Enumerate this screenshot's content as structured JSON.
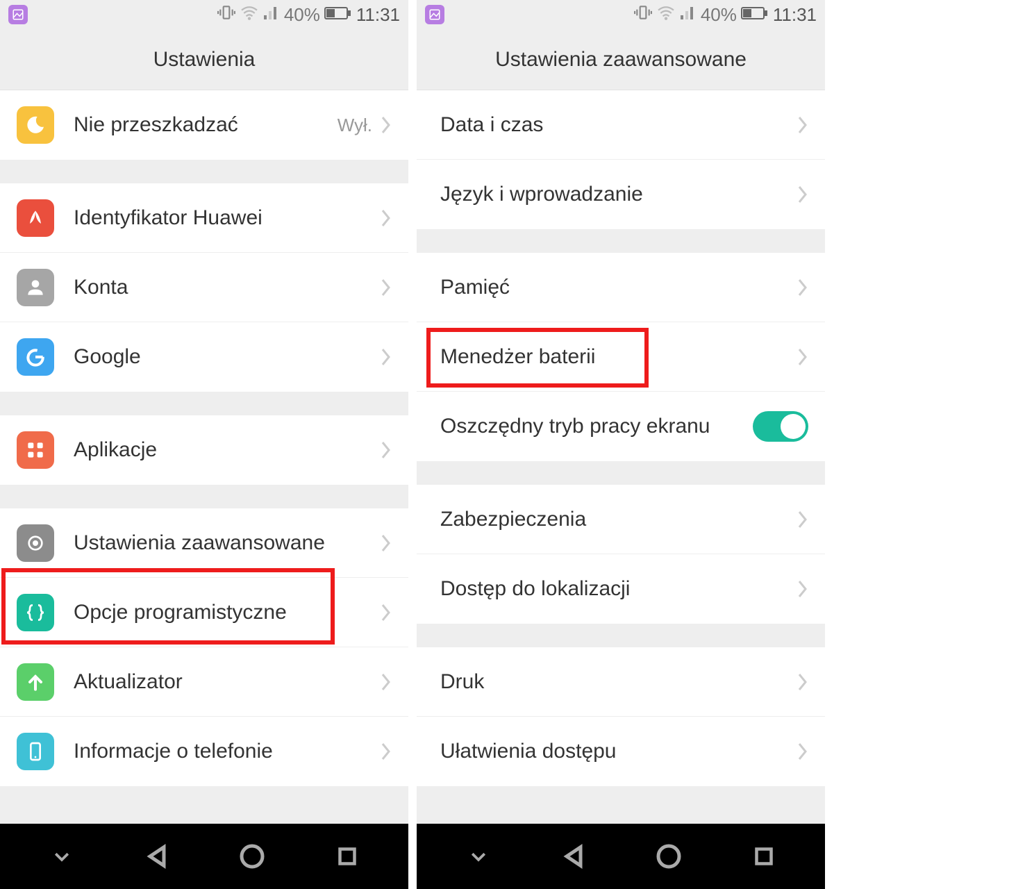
{
  "status": {
    "battery_pct": "40%",
    "time": "11:31"
  },
  "left": {
    "title": "Ustawienia",
    "rows": {
      "dnd": {
        "label": "Nie przeszkadzać",
        "value": "Wył."
      },
      "huawei_id": {
        "label": "Identyfikator Huawei"
      },
      "accounts": {
        "label": "Konta"
      },
      "google": {
        "label": "Google"
      },
      "apps": {
        "label": "Aplikacje"
      },
      "advanced": {
        "label": "Ustawienia zaawansowane"
      },
      "dev": {
        "label": "Opcje programistyczne"
      },
      "updater": {
        "label": "Aktualizator"
      },
      "about": {
        "label": "Informacje o telefonie"
      }
    }
  },
  "right": {
    "title": "Ustawienia zaawansowane",
    "rows": {
      "datetime": {
        "label": "Data i czas"
      },
      "lang": {
        "label": "Język i wprowadzanie"
      },
      "memory": {
        "label": "Pamięć"
      },
      "battery": {
        "label": "Menedżer baterii"
      },
      "eco_screen": {
        "label": "Oszczędny tryb pracy ekranu"
      },
      "security": {
        "label": "Zabezpieczenia"
      },
      "location": {
        "label": "Dostęp do lokalizacji"
      },
      "print": {
        "label": "Druk"
      },
      "accessibility": {
        "label": "Ułatwienia dostępu"
      }
    }
  }
}
